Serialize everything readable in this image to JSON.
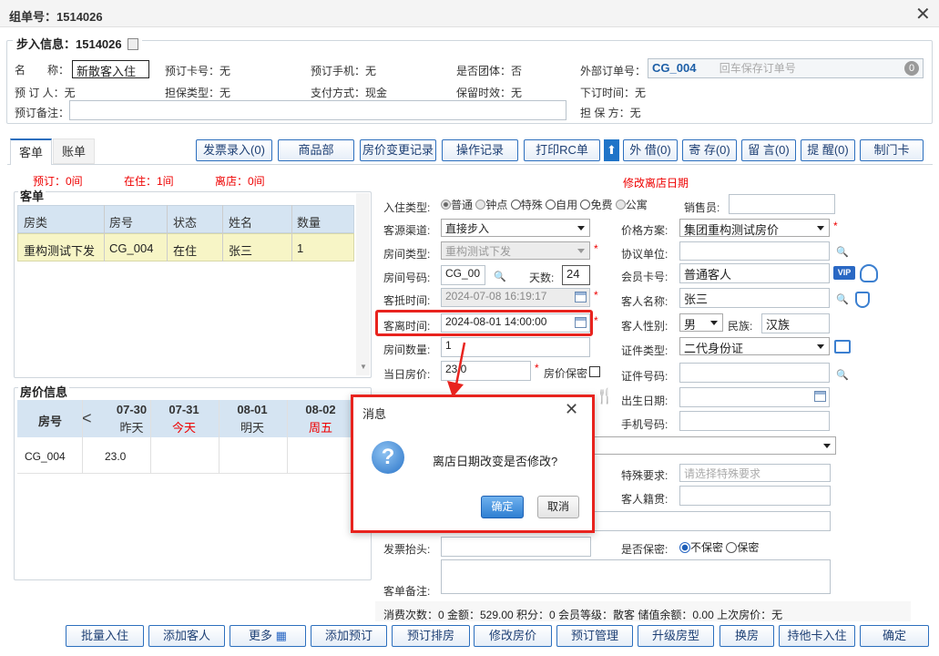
{
  "window": {
    "title": "组单号：1514026"
  },
  "guest": {
    "legend": "步入信息：1514026",
    "name_label": "名　　称：",
    "name_value": "新散客入住",
    "card_label": "预订卡号：无",
    "phone_label": "预订手机：无",
    "group_label": "是否团体：否",
    "ext_order_label": "外部订单号：",
    "ext_order_value": "CG_004",
    "ext_order_hint": "回车保存订单号",
    "ext_order_badge": "0",
    "booker_label": "预 订 人：无",
    "guarantee_label": "担保类型：无",
    "pay_label": "支付方式：现金",
    "keep_label": "保留时效：无",
    "order_time_label": "下订时间：无",
    "remark_label": "预订备注：",
    "guarantor_label": "担 保 方：无"
  },
  "tabs": {
    "items": [
      "客单",
      "账单"
    ]
  },
  "toolbar": {
    "buttons": [
      "发票录入(0)",
      "商品部",
      "房价变更记录",
      "操作记录",
      "打印RC单",
      "外 借(0)",
      "寄 存(0)",
      "留 言(0)",
      "提 醒(0)",
      "制门卡"
    ]
  },
  "summary": {
    "booked": "预订：0间",
    "inhouse": "在住：1间",
    "left": "离店：0间",
    "notice": "修改离店日期"
  },
  "guest_list": {
    "title": "客单",
    "columns": [
      "房类",
      "房号",
      "状态",
      "姓名",
      "数量"
    ],
    "rows": [
      [
        "重构测试下发",
        "CG_004",
        "在住",
        "张三",
        "1"
      ]
    ]
  },
  "price": {
    "title": "房价信息",
    "room_header": "房号",
    "days": [
      {
        "date": "07-30",
        "tag": "昨天",
        "red": false
      },
      {
        "date": "07-31",
        "tag": "今天",
        "red": true
      },
      {
        "date": "08-01",
        "tag": "明天",
        "red": false
      },
      {
        "date": "08-02",
        "tag": "周五",
        "red": true
      }
    ],
    "room": "CG_004",
    "values": [
      "23.0",
      "",
      "",
      ""
    ]
  },
  "form": {
    "checkin_type_label": "入住类型:",
    "checkin_types": [
      "普通",
      "钟点",
      "特殊",
      "自用",
      "免费",
      "公寓"
    ],
    "sales_label": "销售员:",
    "channel_label": "客源渠道:",
    "channel_value": "直接步入",
    "price_plan_label": "价格方案:",
    "price_plan_value": "集团重构测试房价",
    "room_type_label": "房间类型:",
    "room_type_value": "重构测试下发",
    "agreement_label": "协议单位:",
    "room_no_label": "房间号码:",
    "room_no_value": "CG_00",
    "days_label": "天数:",
    "days_value": "24",
    "member_label": "会员卡号:",
    "member_value": "普通客人",
    "arrive_label": "客抵时间:",
    "arrive_value": "2024-07-08 16:19:17",
    "guest_name_label": "客人名称:",
    "guest_name_value": "张三",
    "depart_label": "客离时间:",
    "depart_value": "2024-08-01 14:00:00",
    "gender_label": "客人性别:",
    "gender_value": "男",
    "nation_label": "民族:",
    "nation_value": "汉族",
    "rooms_label": "房间数量:",
    "rooms_value": "1",
    "idtype_label": "证件类型:",
    "idtype_value": "二代身份证",
    "dayprice_label": "当日房价:",
    "dayprice_value": "23.0",
    "secret_price_label": "房价保密",
    "idno_label": "证件号码:",
    "birth_label": "出生日期:",
    "mobile_label": "手机号码:",
    "special_label": "特殊要求:",
    "special_hint": "请选择特殊要求",
    "native_label": "客人籍贯:",
    "invoice_label": "发票抬头:",
    "privacy_label": "是否保密:",
    "privacy_options": [
      "不保密",
      "保密"
    ],
    "remark_label": "客单备注:"
  },
  "status_bar": {
    "text": "消费次数：0 金额：529.00 积分：0 会员等级：散客 储值余额：0.00 上次房价：无"
  },
  "dialog": {
    "title": "消息",
    "message": "离店日期改变是否修改?",
    "ok": "确定",
    "cancel": "取消"
  },
  "bottom": {
    "buttons": [
      "批量入住",
      "添加客人",
      "更多",
      "添加预订",
      "预订排房",
      "修改房价",
      "预订管理",
      "升级房型",
      "换房",
      "持他卡入住",
      "确定"
    ]
  }
}
